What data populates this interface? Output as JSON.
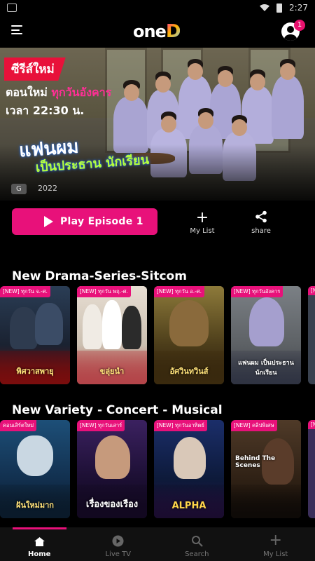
{
  "status_bar": {
    "time": "2:27"
  },
  "header": {
    "logo_text": "one",
    "logo_d": "D",
    "notification_count": "1"
  },
  "hero": {
    "badge": "ซีรีส์ใหม่",
    "line1_prefix": "ตอนใหม่ ",
    "line1_highlight": "ทุกวันอังคาร",
    "line2": "เวลา 22:30 น.",
    "title_main": "แฟนผม",
    "title_sub": "เป็นประธาน นักเรียน",
    "rating": "G",
    "year": "2022"
  },
  "actions": {
    "play_label": "Play Episode 1",
    "mylist_icon": "plus-icon",
    "mylist_label": "My List",
    "share_icon": "share-icon",
    "share_label": "share"
  },
  "sections": [
    {
      "title": "New Drama-Series-Sitcom",
      "cards": [
        {
          "tag": "[NEW] ทุกวัน จ.-ศ.",
          "title": "พิศวาสพายุ"
        },
        {
          "tag": "[NEW] ทุกวัน พฤ.-ศ.",
          "title": "ขลุ่ยนำ"
        },
        {
          "tag": "[NEW] ทุกวัน อ.-ศ.",
          "title": "อัศวินทวินส์"
        },
        {
          "tag": "[NEW] ทุกวันอังคาร",
          "title": "แฟนผม เป็นประธาน นักเรียน"
        },
        {
          "tag": "[NEW]",
          "title": ""
        }
      ]
    },
    {
      "title": "New Variety - Concert - Musical",
      "cards": [
        {
          "tag": "คอนเสิร์ตใหม่",
          "title": "ฝันใหม่มาก"
        },
        {
          "tag": "[NEW] ทุกวันเสาร์",
          "title": "เรื่องของเรือง"
        },
        {
          "tag": "[NEW] ทุกวันอาทิตย์",
          "title": "ALPHA"
        },
        {
          "tag": "[NEW] คลิปพิเศษ",
          "title": "Behind The Scenes"
        },
        {
          "tag": "[NEW]",
          "title": ""
        }
      ]
    }
  ],
  "bottom_nav": [
    {
      "icon": "home-icon",
      "label": "Home",
      "active": true
    },
    {
      "icon": "live-tv-icon",
      "label": "Live TV",
      "active": false
    },
    {
      "icon": "search-icon",
      "label": "Search",
      "active": false
    },
    {
      "icon": "plus-icon",
      "label": "My List",
      "active": false
    }
  ],
  "colors": {
    "accent": "#e8117a",
    "background": "#000000"
  }
}
